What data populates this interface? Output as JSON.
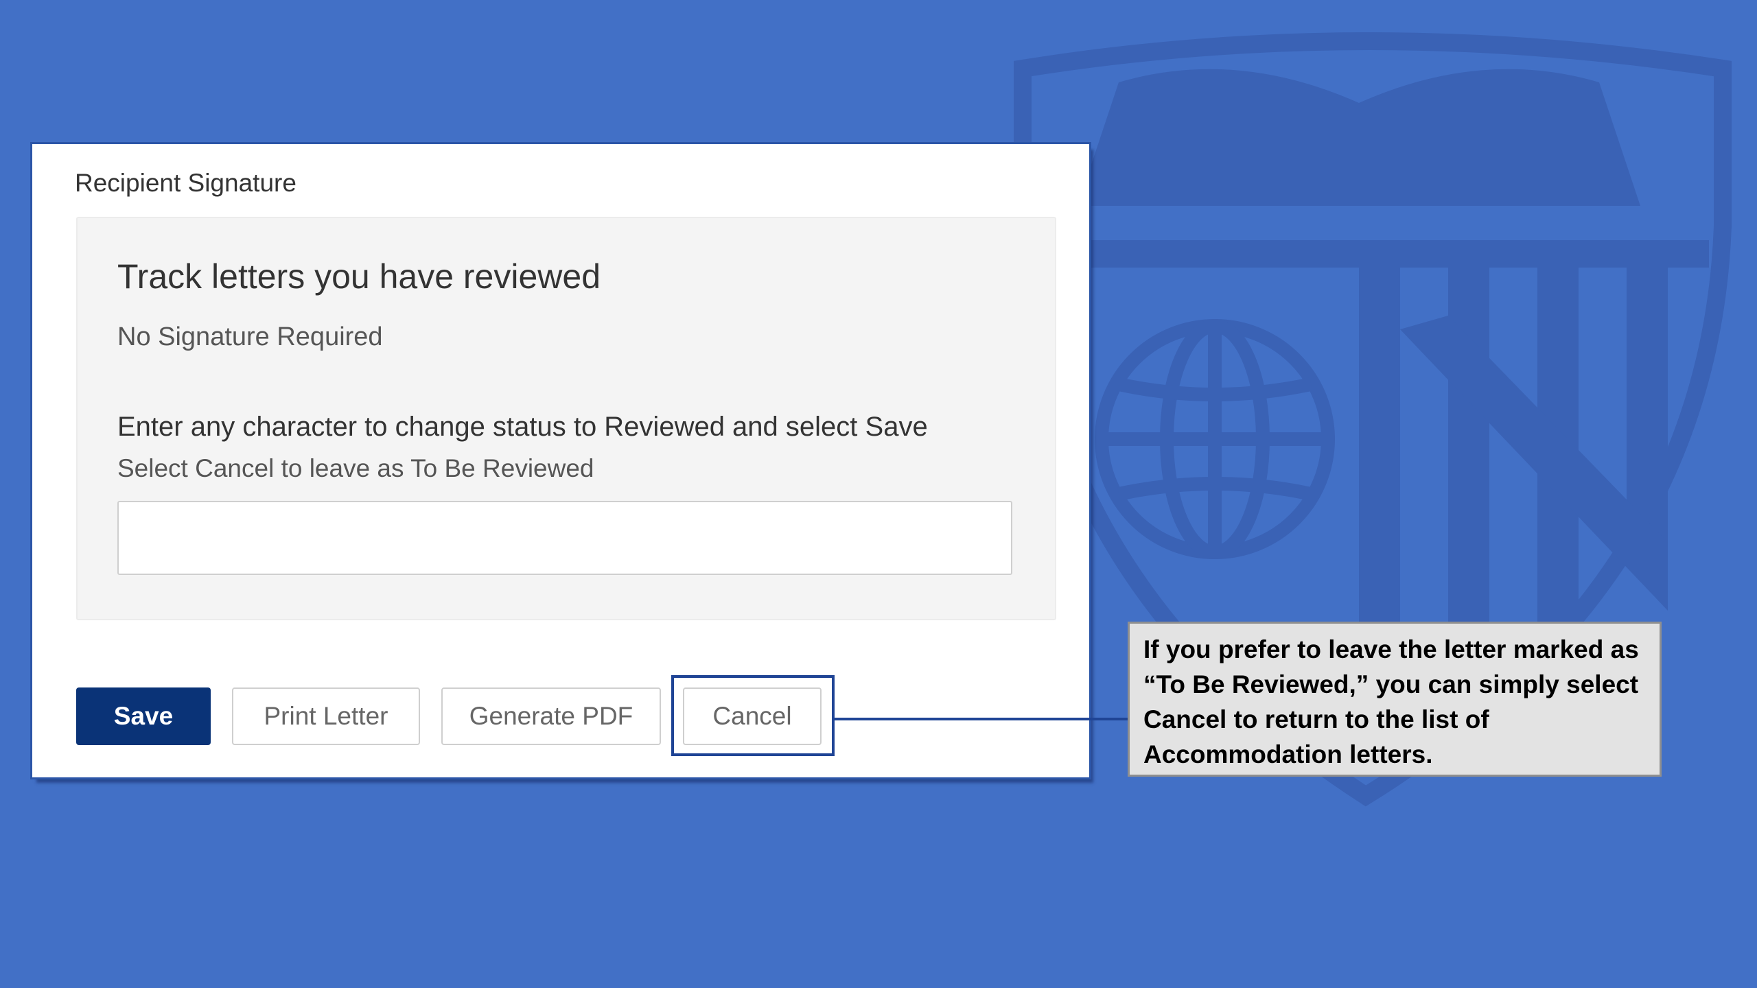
{
  "dialog": {
    "title": "Recipient Signature",
    "panel": {
      "heading": "Track letters you have reviewed",
      "signature_status": "No Signature Required",
      "instruction": "Enter any character to change status to Reviewed and select Save",
      "cancel_hint": "Select Cancel to leave as To Be Reviewed",
      "input_value": "",
      "input_placeholder": ""
    },
    "buttons": {
      "save": "Save",
      "print_letter": "Print Letter",
      "generate_pdf": "Generate PDF",
      "cancel": "Cancel"
    }
  },
  "callout": {
    "text": "If you prefer to leave the letter marked as “To Be Reviewed,” you can simply select Cancel to return to the list of Accommodation letters."
  },
  "colors": {
    "background": "#4270c6",
    "save_button": "#0a3377",
    "highlight": "#1f4495",
    "callout_bg": "#e3e3e3"
  },
  "icons": {
    "background": "university-crest-watermark"
  }
}
